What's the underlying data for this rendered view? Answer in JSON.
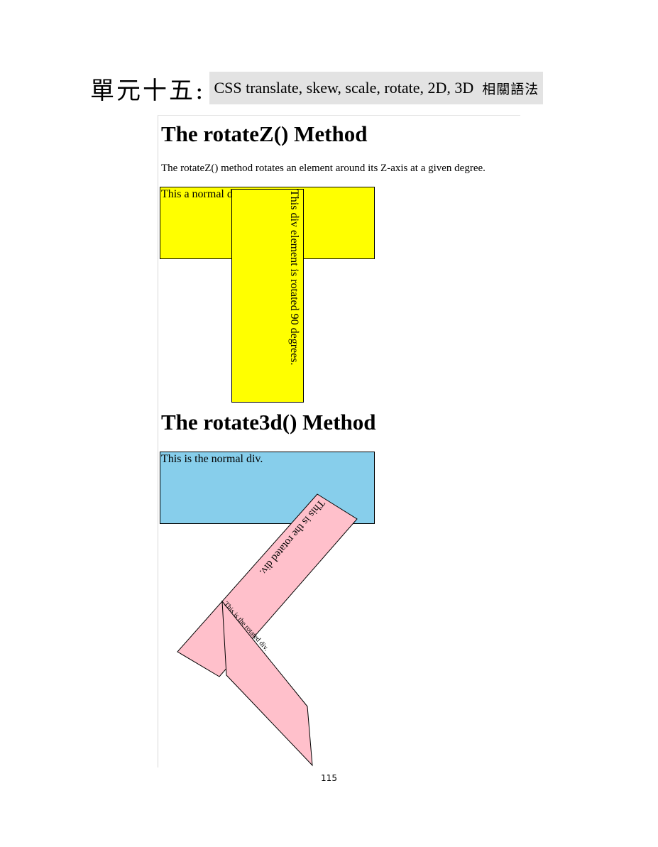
{
  "header": {
    "unit": "單元十五:",
    "topic_en": "CSS translate, skew, scale, rotate, 2D, 3D",
    "topic_zh": "相關語法"
  },
  "rotatez": {
    "heading": "The rotateZ() Method",
    "description": "The rotateZ() method rotates an element around its Z-axis at a given degree.",
    "normal_text": "This a normal div.",
    "rotated_text": "This div element is rotated 90 degrees."
  },
  "rotate3d": {
    "heading": "The rotate3d() Method",
    "normal_text": "This is the normal div.",
    "rotated_text": "This is the rotated div.",
    "rotated_text_mirror": "This is the rotated div."
  },
  "footer": {
    "page_number": "115"
  }
}
